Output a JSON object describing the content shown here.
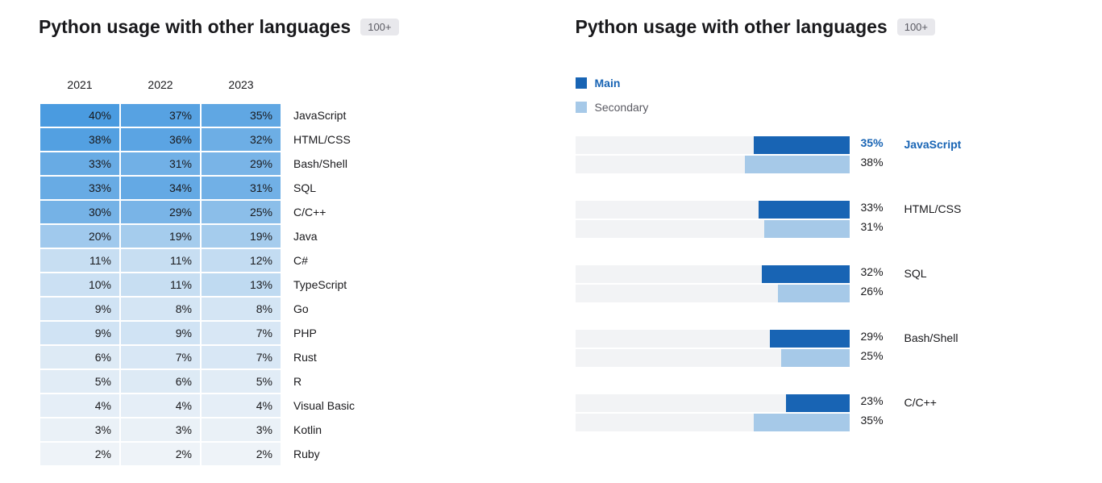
{
  "left": {
    "title": "Python usage with other languages",
    "badge": "100+",
    "years": [
      "2021",
      "2022",
      "2023"
    ],
    "rows": [
      {
        "label": "JavaScript",
        "values": [
          40,
          37,
          35
        ]
      },
      {
        "label": "HTML/CSS",
        "values": [
          38,
          36,
          32
        ]
      },
      {
        "label": "Bash/Shell",
        "values": [
          33,
          31,
          29
        ]
      },
      {
        "label": "SQL",
        "values": [
          33,
          34,
          31
        ]
      },
      {
        "label": "C/C++",
        "values": [
          30,
          29,
          25
        ]
      },
      {
        "label": "Java",
        "values": [
          20,
          19,
          19
        ]
      },
      {
        "label": "C#",
        "values": [
          11,
          11,
          12
        ]
      },
      {
        "label": "TypeScript",
        "values": [
          10,
          11,
          13
        ]
      },
      {
        "label": "Go",
        "values": [
          9,
          8,
          8
        ]
      },
      {
        "label": "PHP",
        "values": [
          9,
          9,
          7
        ]
      },
      {
        "label": "Rust",
        "values": [
          6,
          7,
          7
        ]
      },
      {
        "label": "R",
        "values": [
          5,
          6,
          5
        ]
      },
      {
        "label": "Visual Basic",
        "values": [
          4,
          4,
          4
        ]
      },
      {
        "label": "Kotlin",
        "values": [
          3,
          3,
          3
        ]
      },
      {
        "label": "Ruby",
        "values": [
          2,
          2,
          2
        ]
      }
    ]
  },
  "right": {
    "title": "Python usage with other languages",
    "badge": "100+",
    "legend": {
      "main": "Main",
      "secondary": "Secondary"
    },
    "rows": [
      {
        "label": "JavaScript",
        "main": 35,
        "secondary": 38,
        "highlight": true
      },
      {
        "label": "HTML/CSS",
        "main": 33,
        "secondary": 31,
        "highlight": false
      },
      {
        "label": "SQL",
        "main": 32,
        "secondary": 26,
        "highlight": false
      },
      {
        "label": "Bash/Shell",
        "main": 29,
        "secondary": 25,
        "highlight": false
      },
      {
        "label": "C/C++",
        "main": 23,
        "secondary": 35,
        "highlight": false
      }
    ]
  },
  "colors": {
    "main": "#1864b4",
    "secondary": "#a6c9e8",
    "track": "#f2f3f5",
    "heatmap_scale": {
      "min": "#eef3f8",
      "max": "#4a9be0"
    }
  },
  "chart_data": [
    {
      "type": "heatmap",
      "title": "Python usage with other languages",
      "xlabel": "",
      "ylabel": "",
      "x": [
        "2021",
        "2022",
        "2023"
      ],
      "y": [
        "JavaScript",
        "HTML/CSS",
        "Bash/Shell",
        "SQL",
        "C/C++",
        "Java",
        "C#",
        "TypeScript",
        "Go",
        "PHP",
        "Rust",
        "R",
        "Visual Basic",
        "Kotlin",
        "Ruby"
      ],
      "z": [
        [
          40,
          37,
          35
        ],
        [
          38,
          36,
          32
        ],
        [
          33,
          31,
          29
        ],
        [
          33,
          34,
          31
        ],
        [
          30,
          29,
          25
        ],
        [
          20,
          19,
          19
        ],
        [
          11,
          11,
          12
        ],
        [
          10,
          11,
          13
        ],
        [
          9,
          8,
          8
        ],
        [
          9,
          9,
          7
        ],
        [
          6,
          7,
          7
        ],
        [
          5,
          6,
          5
        ],
        [
          4,
          4,
          4
        ],
        [
          3,
          3,
          3
        ],
        [
          2,
          2,
          2
        ]
      ],
      "unit": "%"
    },
    {
      "type": "bar",
      "title": "Python usage with other languages",
      "orientation": "horizontal",
      "categories": [
        "JavaScript",
        "HTML/CSS",
        "SQL",
        "Bash/Shell",
        "C/C++"
      ],
      "series": [
        {
          "name": "Main",
          "values": [
            35,
            33,
            32,
            29,
            23
          ]
        },
        {
          "name": "Secondary",
          "values": [
            38,
            31,
            26,
            25,
            35
          ]
        }
      ],
      "unit": "%",
      "xlim": [
        0,
        100
      ]
    }
  ]
}
